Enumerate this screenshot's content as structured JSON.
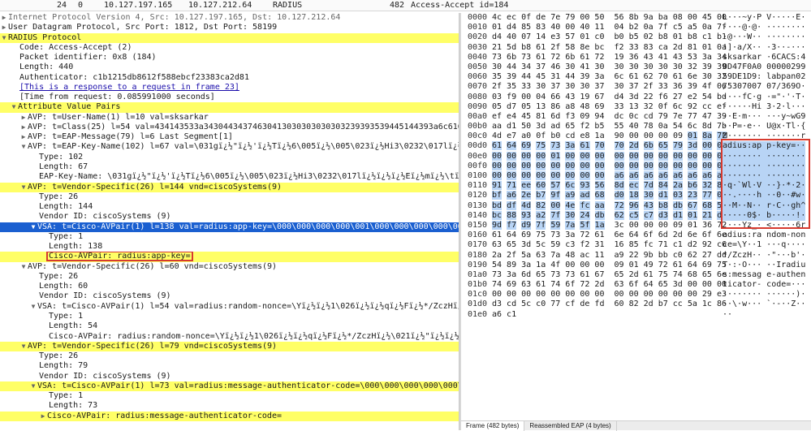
{
  "packet_list": {
    "number": "24",
    "time": "0",
    "source": "10.127.197.165",
    "destination": "10.127.212.64",
    "protocol": "RADIUS",
    "length": "482",
    "info": "Access-Accept id=184"
  },
  "details": {
    "row_ip": "Internet Protocol Version 4, Src: 10.127.197.165, Dst: 10.127.212.64",
    "row_udp": "User Datagram Protocol, Src Port: 1812, Dst Port: 58199",
    "row_radius": "RADIUS Protocol",
    "row_code": "Code: Access-Accept (2)",
    "row_ident": "Packet identifier: 0x8 (184)",
    "row_length": "Length: 440",
    "row_auth": "Authenticator: c1b1215db8612f588ebcf23383ca2d81",
    "row_response_link": "[This is a response to a request in frame 23]",
    "row_time": "[Time from request: 0.085991000 seconds]",
    "row_avp": "Attribute Value Pairs",
    "row_avp_user": "AVP: t=User-Name(1) l=10 val=sksarkar",
    "row_avp_class": "AVP: t=Class(25) l=54 val=434143533a34304434374630413030303030303239393539445144393a6c61627",
    "row_avp_eap": "AVP: t=EAP-Message(79) l=6 Last Segment[1]",
    "row_avp_eapkey": "AVP: t=EAP-Key-Name(102) l=67 val=\\031gï¿½\"ï¿½'ï¿½Tï¿½6\\005ï¿½\\005\\023ï¿½Hi3\\0232\\017lï¿½ï¿½ï¿½Eï¿½mï¿½\\tï¿½ï¿½~fï¿½y~w",
    "row_eapkey_type": "Type: 102",
    "row_eapkey_len": "Length: 67",
    "row_eapkey_name": "EAP-Key-Name: \\031gï¿½\"ï¿½'ï¿½Tï¿½6\\005ï¿½\\005\\023ï¿½Hi3\\0232\\017lï¿½ï¿½ï¿½Eï¿½mï¿½\\tï¿½ï¿½~fï¿½y~wG9ï¿½ï¿½P=ï¿½eï¿½U@x\\nTlï¿½",
    "row_vs1": "AVP: t=Vendor-Specific(26) l=144 vnd=ciscoSystems(9)",
    "row_vs1_type": "Type: 26",
    "row_vs1_len": "Length: 144",
    "row_vs1_vid": "Vendor ID: ciscoSystems (9)",
    "row_vsa1": "VSA: t=Cisco-AVPair(1) l=138 val=radius:app-key=\\000\\000\\000\\000\\001\\000\\000\\000\\000\\000\\000\\000\\000\\000\\000",
    "row_vsa1_type": "Type: 1",
    "row_vsa1_len": "Length: 138",
    "row_vsa1_pair": "Cisco-AVPair: radius:app-key=",
    "row_vs2": "AVP: t=Vendor-Specific(26) l=60 vnd=ciscoSystems(9)",
    "row_vs2_type": "Type: 26",
    "row_vs2_len": "Length: 60",
    "row_vs2_vid": "Vendor ID: ciscoSystems (9)",
    "row_vsa2": "VSA: t=Cisco-AVPair(1) l=54 val=radius:random-nonce=\\Yï¿½ï¿½1\\026ï¿½ï¿½qï¿½Fï¿½*/ZczHï¿½\\021ï¿½\"ï¿½ï¿½ï¿½b'ï¿½Tï¿½:",
    "row_vsa2_type": "Type: 1",
    "row_vsa2_len": "Length: 54",
    "row_vsa2_pair": "Cisco-AVPair: radius:random-nonce=\\Yï¿½ï¿½1\\026ï¿½ï¿½qï¿½Fï¿½*/ZczHï¿½\\021ï¿½\"ï¿½ï¿½ï¿½b'ï¿½Tï¿½:",
    "row_vs3": "AVP: t=Vendor-Specific(26) l=79 vnd=ciscoSystems(9)",
    "row_vs3_type": "Type: 26",
    "row_vs3_len": "Length: 79",
    "row_vs3_vid": "Vendor ID: ciscoSystems (9)",
    "row_vsa3": "VSA: t=Cisco-AVPair(1) l=73 val=radius:message-authenticator-code=\\000\\000\\000\\000\\000\\000\\000\\",
    "row_vsa3_type": "Type: 1",
    "row_vsa3_len": "Length: 73",
    "row_vsa3_pair": "Cisco-AVPair: radius:message-authenticator-code="
  },
  "bytes": {
    "rows": [
      {
        "off": "0000",
        "hex": "4c ec 0f de 7e 79 00 50  56 8b 9a ba 08 00 45 00",
        "asc": "L···~y·P V·····E·"
      },
      {
        "off": "0010",
        "hex": "01 d4 85 83 40 00 40 11  04 b2 0a 7f c5 a5 0a 7f",
        "asc": "····@·@· ········"
      },
      {
        "off": "0020",
        "hex": "d4 40 07 14 e3 57 01 c0  b0 b5 02 b8 01 b8 c1 b1",
        "asc": "·@···W·· ········"
      },
      {
        "off": "0030",
        "hex": "21 5d b8 61 2f 58 8e bc  f2 33 83 ca 2d 81 01 0a",
        "asc": "!]·a/X·· ·3··-···"
      },
      {
        "off": "0040",
        "hex": "73 6b 73 61 72 6b 61 72  19 36 43 41 43 53 3a 34",
        "asc": "sksarkar ·6CACS:4"
      },
      {
        "off": "0050",
        "hex": "30 44 34 37 46 30 41 30  30 30 30 30 30 32 39 39",
        "asc": "0D47F0A0 00000299"
      },
      {
        "off": "0060",
        "hex": "35 39 44 45 31 44 39 3a  6c 61 62 70 61 6e 30 32",
        "asc": "59DE1D9: labpan02"
      },
      {
        "off": "0070",
        "hex": "2f 35 33 30 37 30 30 37  30 37 2f 33 36 39 4f 06",
        "asc": "/5307007 07/369O·"
      },
      {
        "off": "0080",
        "hex": "03 f9 00 04 66 43 19 67  d4 3d 22 f6 27 e2 54 bd",
        "asc": "····fC·g ·=\"·'·T·"
      },
      {
        "off": "0090",
        "hex": "05 d7 05 13 86 a8 48 69  33 13 32 0f 6c 92 cc ef",
        "asc": "······Hi 3·2·l···"
      },
      {
        "off": "00a0",
        "hex": "ef e4 45 81 6d f3 09 94  dc 0c cd 79 7e 77 47 39",
        "asc": "··E·m··· ···y~wG9"
      },
      {
        "off": "00b0",
        "hex": "aa d1 50 3d ad 65 f2 b5  55 40 78 0a 54 6c 8d 7b",
        "asc": "··P=·e·· U@x·Tl·{"
      },
      {
        "off": "00c0",
        "hex": "4d e7 a0 0f b0 cd e8 1a  90 00 00 00 09 01 8a 72",
        "asc": "M······· ·······r",
        "sel_from": 13
      },
      {
        "off": "00d0",
        "hex": "61 64 69 75 73 3a 61 70  70 2d 6b 65 79 3d 00 00",
        "asc": "adius:ap p-key=··",
        "sel_all": true
      },
      {
        "off": "00e0",
        "hex": "00 00 00 00 01 00 00 00  00 00 00 00 00 00 00 00",
        "asc": "········ ········",
        "sel_all": true
      },
      {
        "off": "00f0",
        "hex": "00 00 00 00 00 00 00 00  00 00 00 00 00 00 00 00",
        "asc": "········ ········",
        "sel_all": true
      },
      {
        "off": "0100",
        "hex": "00 00 00 00 00 00 00 00  a6 a6 a6 a6 a6 a6 a6 ad",
        "asc": "········ ········",
        "sel_all": true
      },
      {
        "off": "0110",
        "hex": "91 71 ee 60 57 6c 93 56  8d ec 7d 84 2a b6 32 85",
        "asc": "·q·`Wl·V ··}·*·2·",
        "sel_all": true
      },
      {
        "off": "0120",
        "hex": "bf a6 2e b7 9f a9 ad 68  d0 18 30 d1 03 23 77 03",
        "asc": "··.····h ··0··#w·",
        "sel_all": true
      },
      {
        "off": "0130",
        "hex": "bd df 4d 82 00 4e fc aa  72 96 43 b8 db 67 68 5e",
        "asc": "··M··N·· r·C··gh^",
        "sel_all": true
      },
      {
        "off": "0140",
        "hex": "bc 88 93 a2 7f 30 24 db  62 c5 c7 d3 d1 01 21 d3",
        "asc": "·····0$· b·····!·",
        "sel_all": true
      },
      {
        "off": "0150",
        "hex": "9d f7 d9 7f 59 7a 5f 1a  3c 00 00 00 09 01 36 72",
        "asc": "····Yz_· <·····6r",
        "sel_to": 8
      },
      {
        "off": "0160",
        "hex": "61 64 69 75 73 3a 72 61  6e 64 6f 6d 2d 6e 6f 6e",
        "asc": "adius:ra ndom-non"
      },
      {
        "off": "0170",
        "hex": "63 65 3d 5c 59 c3 f2 31  16 85 fc 71 c1 d2 92 c6",
        "asc": "ce=\\Y··1 ···q····"
      },
      {
        "off": "0180",
        "hex": "2a 2f 5a 63 7a 48 ac 11  a9 22 9b bb c0 62 27 dd",
        "asc": "*/ZczH·· ·\"···b'·"
      },
      {
        "off": "0190",
        "hex": "54 89 3a 1a 4f 00 00 00  09 01 49 72 61 64 69 75",
        "asc": "T·:·O··· ··Iradiu"
      },
      {
        "off": "01a0",
        "hex": "73 3a 6d 65 73 73 61 67  65 2d 61 75 74 68 65 6e",
        "asc": "s:messag e-authen"
      },
      {
        "off": "01b0",
        "hex": "74 69 63 61 74 6f 72 2d  63 6f 64 65 3d 00 00 00",
        "asc": "ticator- code=···"
      },
      {
        "off": "01c0",
        "hex": "00 00 00 00 00 00 00 00  00 00 00 00 00 00 29 e3",
        "asc": "········ ······)·"
      },
      {
        "off": "01d0",
        "hex": "d3 cd 5c c0 77 cf de fd  60 82 2d b7 cc 5a 1c 86",
        "asc": "··\\·w··· `·-··Z··"
      },
      {
        "off": "01e0",
        "hex": "a6 c1",
        "asc": "··"
      }
    ],
    "tabs": [
      "Frame (482 bytes)",
      "Reassembled EAP (4 bytes)"
    ]
  }
}
